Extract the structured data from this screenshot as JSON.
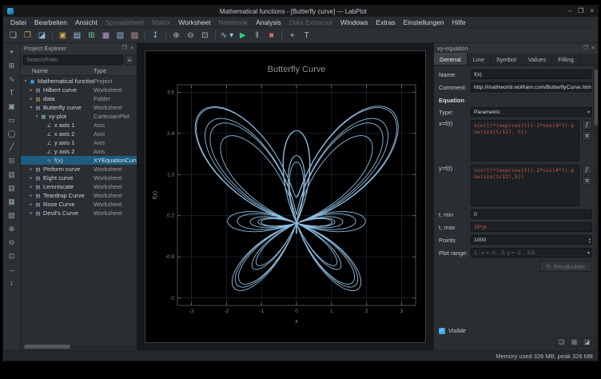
{
  "window": {
    "title": "Mathematical functions - [Butterfly curve] — LabPlot",
    "controls": {
      "minimize": "–",
      "maximize": "❐",
      "close": "×"
    }
  },
  "dock_controls": {
    "float_glyph": "❐",
    "close_glyph": "×"
  },
  "menubar": {
    "items": [
      {
        "label": "Datei",
        "enabled": true
      },
      {
        "label": "Bearbeiten",
        "enabled": true
      },
      {
        "label": "Ansicht",
        "enabled": true
      },
      {
        "label": "Spreadsheet",
        "enabled": false
      },
      {
        "label": "Matrix",
        "enabled": false
      },
      {
        "label": "Worksheet",
        "enabled": true
      },
      {
        "label": "Notebook",
        "enabled": false
      },
      {
        "label": "Analysis",
        "enabled": true
      },
      {
        "label": "Data Extractor",
        "enabled": false
      },
      {
        "label": "Windows",
        "enabled": true
      },
      {
        "label": "Extras",
        "enabled": true
      },
      {
        "label": "Einstellungen",
        "enabled": true
      },
      {
        "label": "Hilfe",
        "enabled": true
      }
    ]
  },
  "toolbar": {
    "items": [
      {
        "name": "new-project-button",
        "glyph": "❏"
      },
      {
        "name": "open-project-button",
        "glyph": "❐",
        "color": "#d8a657"
      },
      {
        "name": "save-project-button",
        "glyph": "◪",
        "color": "#8fb6d9"
      },
      {
        "sep": true
      },
      {
        "name": "new-folder-button",
        "glyph": "▣",
        "color": "#d8a657"
      },
      {
        "name": "new-workbook-button",
        "glyph": "▤",
        "color": "#9fc4e3"
      },
      {
        "name": "new-spreadsheet-button",
        "glyph": "⊞",
        "color": "#6fcf97"
      },
      {
        "name": "new-matrix-button",
        "glyph": "▦",
        "color": "#bf9ddb"
      },
      {
        "name": "new-worksheet-button",
        "glyph": "▧",
        "color": "#8fb6d9"
      },
      {
        "name": "new-notebook-button",
        "glyph": "▨",
        "color": "#d29a9a"
      },
      {
        "sep": true
      },
      {
        "name": "import-data-button",
        "glyph": "↧",
        "color": "#8fb6d9"
      },
      {
        "sep": true
      },
      {
        "name": "zoom-in-button",
        "glyph": "⊕"
      },
      {
        "name": "zoom-out-button",
        "glyph": "⊖"
      },
      {
        "name": "zoom-fit-button",
        "glyph": "⊡"
      },
      {
        "sep": true
      },
      {
        "name": "plot-type-dropdown",
        "glyph": "∿ ▾",
        "color": "#9fc4e3"
      },
      {
        "name": "start-button",
        "glyph": "▶",
        "color": "#2ecc71"
      },
      {
        "name": "pause-button",
        "glyph": "‖"
      },
      {
        "name": "stop-button",
        "glyph": "■",
        "color": "#d86a5f"
      },
      {
        "sep": true
      },
      {
        "name": "select-mode-button",
        "glyph": "⌖"
      },
      {
        "name": "text-mode-button",
        "glyph": "T"
      }
    ]
  },
  "left_toolbar": {
    "items": [
      {
        "name": "navigate-tool",
        "glyph": "⌖"
      },
      {
        "name": "zoom-select-tool",
        "glyph": "⊞"
      },
      {
        "name": "add-curve-tool",
        "glyph": "∿"
      },
      {
        "name": "add-text-tool",
        "glyph": "T"
      },
      {
        "name": "add-image-tool",
        "glyph": "▣"
      },
      {
        "name": "add-rect-tool",
        "glyph": "▭"
      },
      {
        "name": "add-ellipse-tool",
        "glyph": "◯"
      },
      {
        "name": "add-line-tool",
        "glyph": "╱"
      },
      {
        "name": "grid-tool",
        "glyph": "⊟"
      },
      {
        "name": "layout-vertical-tool",
        "glyph": "▥"
      },
      {
        "name": "layout-horizontal-tool",
        "glyph": "▤"
      },
      {
        "name": "layout-grid-tool",
        "glyph": "▦"
      },
      {
        "name": "break-layout-tool",
        "glyph": "▧"
      },
      {
        "name": "zoom-in-tool",
        "glyph": "⊕"
      },
      {
        "name": "zoom-out-tool",
        "glyph": "⊖"
      },
      {
        "name": "fit-page-tool",
        "glyph": "⊡"
      },
      {
        "name": "fit-width-tool",
        "glyph": "↔"
      },
      {
        "name": "fit-height-tool",
        "glyph": "↕"
      }
    ]
  },
  "project_explorer": {
    "title": "Project Explorer",
    "search_placeholder": "Search/Filter",
    "filter_glyph": "≡",
    "columns": {
      "name": "Name",
      "type": "Type"
    },
    "rows": [
      {
        "depth": 0,
        "expander": "▾",
        "icon": "project-icon",
        "glyph": "▣",
        "color": "#3daee9",
        "name": "Mathematical functions",
        "type": "Project",
        "selected": false
      },
      {
        "depth": 1,
        "expander": "▸",
        "icon": "worksheet-icon",
        "glyph": "▤",
        "color": "#8fb6d9",
        "name": "Hilbert curve",
        "type": "Worksheet",
        "selected": false
      },
      {
        "depth": 1,
        "expander": "▸",
        "icon": "folder-icon",
        "glyph": "▨",
        "color": "#d8a657",
        "name": "data",
        "type": "Folder",
        "selected": false
      },
      {
        "depth": 1,
        "expander": "▾",
        "icon": "worksheet-icon",
        "glyph": "▤",
        "color": "#8fb6d9",
        "name": "Butterfly curve",
        "type": "Worksheet",
        "selected": false
      },
      {
        "depth": 2,
        "expander": "▾",
        "icon": "plot-icon",
        "glyph": "▦",
        "color": "#7fb6a0",
        "name": "xy-plot",
        "type": "CartesianPlot",
        "selected": false
      },
      {
        "depth": 3,
        "expander": "",
        "icon": "axis-icon",
        "glyph": "∠",
        "color": "#a9adb1",
        "name": "x axis 1",
        "type": "Axis",
        "selected": false
      },
      {
        "depth": 3,
        "expander": "",
        "icon": "axis-icon",
        "glyph": "∠",
        "color": "#a9adb1",
        "name": "x axis 2",
        "type": "Axis",
        "selected": false
      },
      {
        "depth": 3,
        "expander": "",
        "icon": "axis-icon",
        "glyph": "∠",
        "color": "#a9adb1",
        "name": "y axis 1",
        "type": "Axis",
        "selected": false
      },
      {
        "depth": 3,
        "expander": "",
        "icon": "axis-icon",
        "glyph": "∠",
        "color": "#a9adb1",
        "name": "y axis 2",
        "type": "Axis",
        "selected": false
      },
      {
        "depth": 3,
        "expander": "",
        "icon": "curve-icon",
        "glyph": "∿",
        "color": "#9fc4e3",
        "name": "f(x)",
        "type": "XYEquationCurve",
        "selected": true
      },
      {
        "depth": 1,
        "expander": "▸",
        "icon": "worksheet-icon",
        "glyph": "▤",
        "color": "#8fb6d9",
        "name": "Piriform curve",
        "type": "Worksheet",
        "selected": false
      },
      {
        "depth": 1,
        "expander": "▸",
        "icon": "worksheet-icon",
        "glyph": "▤",
        "color": "#8fb6d9",
        "name": "Eight curve",
        "type": "Worksheet",
        "selected": false
      },
      {
        "depth": 1,
        "expander": "▸",
        "icon": "worksheet-icon",
        "glyph": "▤",
        "color": "#8fb6d9",
        "name": "Lemniscate",
        "type": "Worksheet",
        "selected": false
      },
      {
        "depth": 1,
        "expander": "▸",
        "icon": "worksheet-icon",
        "glyph": "▤",
        "color": "#8fb6d9",
        "name": "Teardrop Curve",
        "type": "Worksheet",
        "selected": false
      },
      {
        "depth": 1,
        "expander": "▸",
        "icon": "worksheet-icon",
        "glyph": "▤",
        "color": "#8fb6d9",
        "name": "Rose Curve",
        "type": "Worksheet",
        "selected": false
      },
      {
        "depth": 1,
        "expander": "▸",
        "icon": "worksheet-icon",
        "glyph": "▤",
        "color": "#8fb6d9",
        "name": "Devil's Curve",
        "type": "Worksheet",
        "selected": false
      }
    ]
  },
  "chart_data": {
    "type": "line",
    "title": "Butterfly Curve",
    "xlabel": "x",
    "ylabel": "f(x)",
    "equation_type": "Parametric",
    "x_equation": "sin(t)*(exp(cos(t))-2*cos(4*t)-pow(sin(t/12), 5))",
    "y_equation": "cos(t)*(exp(cos(t))-2*cos(4*t)-pow(sin(t/12),5))",
    "t_min": "0",
    "t_max": "10*pi",
    "points": 1000,
    "xlim": [
      -3.4,
      3.4
    ],
    "ylim": [
      -2.2,
      3.7
    ],
    "x_ticks": [
      -3,
      -2,
      -1,
      0,
      1,
      2,
      3
    ],
    "y_ticks": [
      -2,
      -0.9,
      0.2,
      1.3,
      2.4,
      3.5
    ],
    "grid": true,
    "curve_color": "#8fbcdf",
    "legend_position": "none"
  },
  "properties": {
    "title": "xy-equation",
    "tabs": [
      "General",
      "Line",
      "Symbol",
      "Values",
      "Filling"
    ],
    "active_tab": "General",
    "name_label": "Name:",
    "name_value": "f(x)",
    "comment_label": "Comment:",
    "comment_value": "http://mathworld.wolfram.com/ButterflyCurve.html",
    "section_equation": "Equation",
    "type_label": "Type:",
    "type_value": "Parametric",
    "x_label": "x=f(t)",
    "x_value": "sin(t)*(exp(cos(t))-2*cos(4*t)-pow(sin(t/12), 5))",
    "y_label": "y=f(t)",
    "y_value": "cos(t)*(exp(cos(t))-2*cos(4*t)-pow(sin(t/12),5))",
    "tmin_label": "t, min",
    "tmin_value": "0",
    "tmax_label": "t, max",
    "tmax_value": "10*pi",
    "points_label": "Points",
    "points_value": "1000",
    "plot_range_label": "Plot range:",
    "plot_range_value": "1 : x = -3 .. 3, y = -2 .. 3.5",
    "recalculate_label": "Recalculate",
    "recalculate_glyph": "↻",
    "visible_label": "Visible",
    "visible_checked": true,
    "check_glyph": "✓",
    "fn_button": "ƒ",
    "pi_button": "π",
    "spin_up": "▴",
    "spin_down": "▾"
  },
  "statusbar": {
    "memory": "Memory used 326 MB, peak 326 MB"
  }
}
